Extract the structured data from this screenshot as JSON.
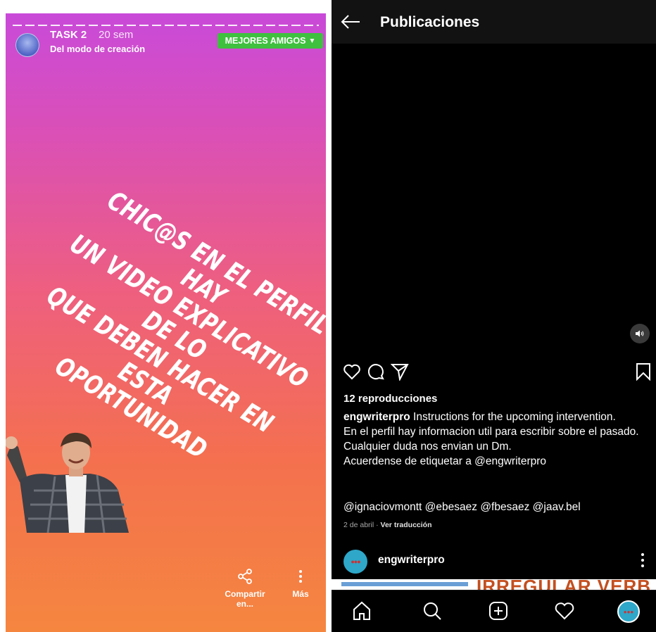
{
  "story": {
    "username": "TASK 2",
    "time": "20 sem",
    "subtitle": "Del modo de creación",
    "audience_label": "MEJORES AMIGOS",
    "audience_color": "#3fc03f",
    "text_lines": [
      "CHIC@S EN EL PERFIL HAY",
      "UN VIDEO EXPLICATIVO DE LO",
      "QUE DEBEN HACER EN ESTA",
      "OPORTUNIDAD"
    ],
    "share_label": "Compartir en...",
    "more_label": "Más"
  },
  "feed": {
    "title": "Publicaciones",
    "views": "12 reproducciones",
    "caption_user": "engwriterpro",
    "caption_lines": [
      "Instructions for the upcoming intervention.",
      "En el perfil hay informacion util para escribir sobre el pasado.",
      "Cualquier duda nos envian un Dm.",
      "Acuerdense de etiquetar a @engwriterpro"
    ],
    "tags": "@ignaciovmontt @ebesaez @fbesaez @jaav.bel",
    "date": "2 de abril",
    "translate": "Ver traducción",
    "next_post_user": "engwriterpro",
    "next_post_avatar_text": "●●●",
    "next_post_image_text": "IRREGULAR VERB"
  },
  "icons": {
    "back": "back-arrow-icon",
    "like": "heart-icon",
    "comment": "comment-icon",
    "share": "send-icon",
    "save": "bookmark-icon",
    "mute": "volume-icon",
    "home": "home-icon",
    "search": "search-icon",
    "add": "add-post-icon",
    "activity": "heart-icon",
    "profile": "profile-avatar-icon"
  }
}
